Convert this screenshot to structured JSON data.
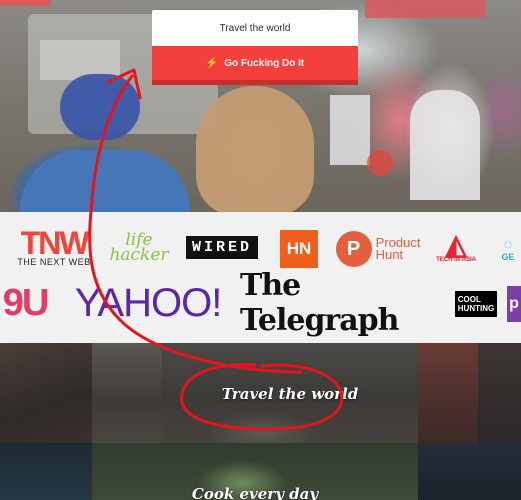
{
  "cta": {
    "title": "Travel the world",
    "button_label": "Go Fucking Do It",
    "button_icon": "lightning-bolt-icon"
  },
  "logos": {
    "row1": {
      "tnw_big": "TNW",
      "tnw_small": "THE NEXT WEB",
      "lifehacker_line1": "life",
      "lifehacker_line2": "hacker",
      "wired": "WIRED",
      "hn": "HN",
      "ph_mark": "P",
      "ph_line1": "Product",
      "ph_line2": "Hunt",
      "techinasia": "TECH IN ASIA",
      "gen_partial": "GE"
    },
    "row2": {
      "ninegu": "9U",
      "yahoo": "YAHOO!",
      "telegraph": "The Telegraph",
      "coolhunting_line1": "COOL",
      "coolhunting_line2": "HUNTING",
      "purple_partial": "p"
    }
  },
  "grid": {
    "tile_travel_label": "Travel the world",
    "tile_cook_label": "Cook every day"
  },
  "colors": {
    "cta_red": "#f3403d",
    "annotation_red": "#e4151c"
  }
}
